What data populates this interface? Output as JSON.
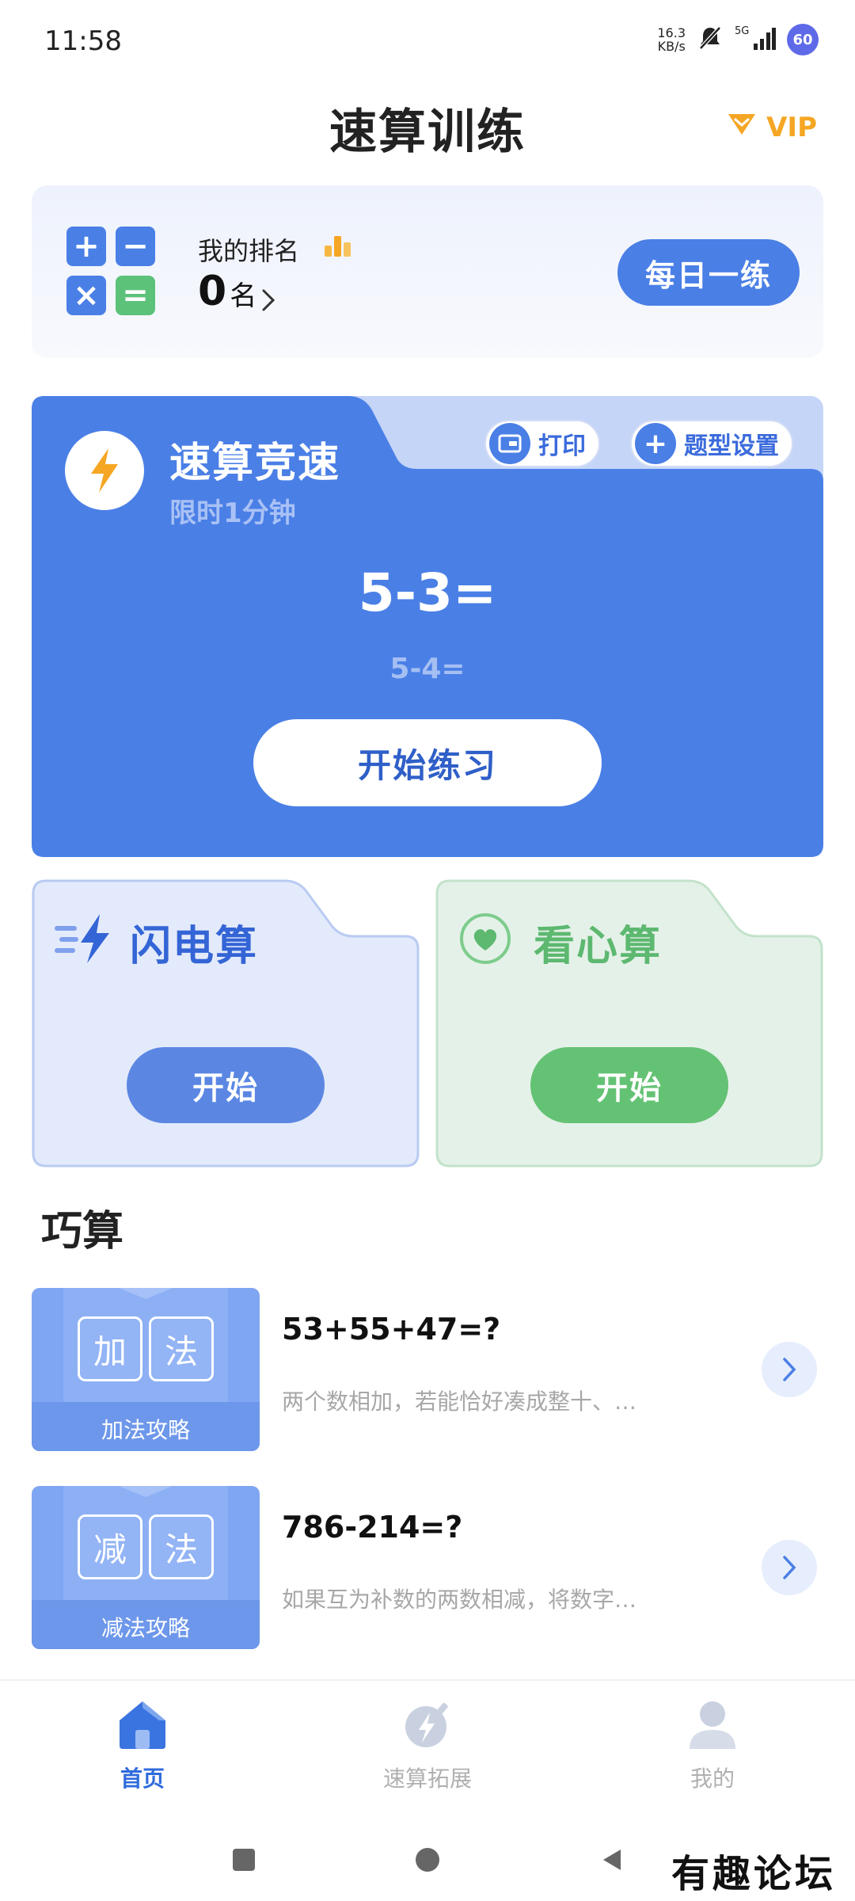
{
  "status_bar": {
    "time": "11:58",
    "net_speed_value": "16.3",
    "net_speed_unit": "KB/s",
    "signal_label": "5G",
    "battery": "60"
  },
  "header": {
    "title": "速算训练",
    "vip_label": "VIP"
  },
  "rank_card": {
    "calc_symbols": [
      "+",
      "−",
      "×",
      "="
    ],
    "label": "我的排名",
    "value": "0",
    "unit": "名",
    "daily_button": "每日一练"
  },
  "race_card": {
    "title": "速算竞速",
    "subtitle": "限时1分钟",
    "print_button": "打印",
    "settings_button": "题型设置",
    "current_expression": "5-3=",
    "next_expression": "5-4=",
    "start_button": "开始练习"
  },
  "modes": [
    {
      "title": "闪电算",
      "button": "开始",
      "icon": "lightning-icon"
    },
    {
      "title": "看心算",
      "button": "开始",
      "icon": "heart-icon"
    }
  ],
  "tricks_section": {
    "title": "巧算",
    "items": [
      {
        "chars": [
          "加",
          "法"
        ],
        "thumb_label": "加法攻略",
        "expression": "53+55+47=?",
        "description": "两个数相加，若能恰好凑成整十、…"
      },
      {
        "chars": [
          "减",
          "法"
        ],
        "thumb_label": "减法攻略",
        "expression": "786-214=?",
        "description": "如果互为补数的两数相减，将数字…"
      }
    ]
  },
  "bottom_nav": {
    "items": [
      {
        "label": "首页",
        "active": true
      },
      {
        "label": "速算拓展",
        "active": false
      },
      {
        "label": "我的",
        "active": false
      }
    ]
  },
  "watermark": "有趣论坛",
  "colors": {
    "primary_blue": "#4a7fe6",
    "green": "#64c274",
    "vip_orange": "#f5a623"
  }
}
